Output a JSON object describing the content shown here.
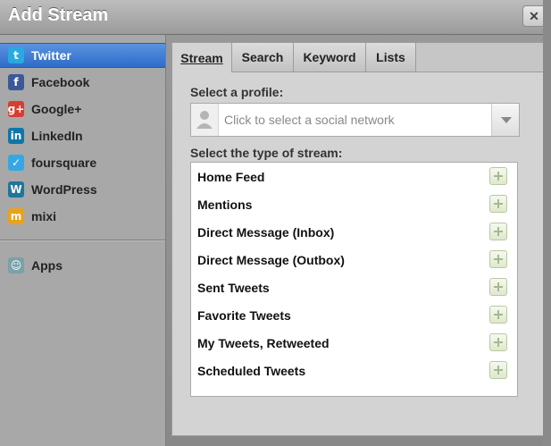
{
  "dialog": {
    "title": "Add Stream",
    "close_glyph": "✕"
  },
  "sidebar": {
    "items": [
      {
        "label": "Twitter",
        "icon": "twitter-icon",
        "glyph": "t",
        "color": "#2aa9e0",
        "selected": true
      },
      {
        "label": "Facebook",
        "icon": "facebook-icon",
        "glyph": "f",
        "color": "#3b5998",
        "selected": false
      },
      {
        "label": "Google+",
        "icon": "google-plus-icon",
        "glyph": "g+",
        "color": "#d73d32",
        "selected": false
      },
      {
        "label": "LinkedIn",
        "icon": "linkedin-icon",
        "glyph": "in",
        "color": "#0e76a8",
        "selected": false
      },
      {
        "label": "foursquare",
        "icon": "foursquare-icon",
        "glyph": "✓",
        "color": "#36a7e3",
        "selected": false
      },
      {
        "label": "WordPress",
        "icon": "wordpress-icon",
        "glyph": "W",
        "color": "#21759b",
        "selected": false
      },
      {
        "label": "mixi",
        "icon": "mixi-icon",
        "glyph": "m",
        "color": "#e9a21b",
        "selected": false
      }
    ],
    "apps": {
      "label": "Apps",
      "icon": "apps-icon",
      "glyph": "☺",
      "color": "#7aa2a8"
    }
  },
  "tabs": [
    {
      "label": "Stream",
      "active": true
    },
    {
      "label": "Search",
      "active": false
    },
    {
      "label": "Keyword",
      "active": false
    },
    {
      "label": "Lists",
      "active": false
    }
  ],
  "profile": {
    "label": "Select a profile:",
    "placeholder": "Click to select a social network"
  },
  "stream_types": {
    "label": "Select the type of stream:",
    "items": [
      "Home Feed",
      "Mentions",
      "Direct Message (Inbox)",
      "Direct Message (Outbox)",
      "Sent Tweets",
      "Favorite Tweets",
      "My Tweets, Retweeted",
      "Scheduled Tweets"
    ]
  }
}
